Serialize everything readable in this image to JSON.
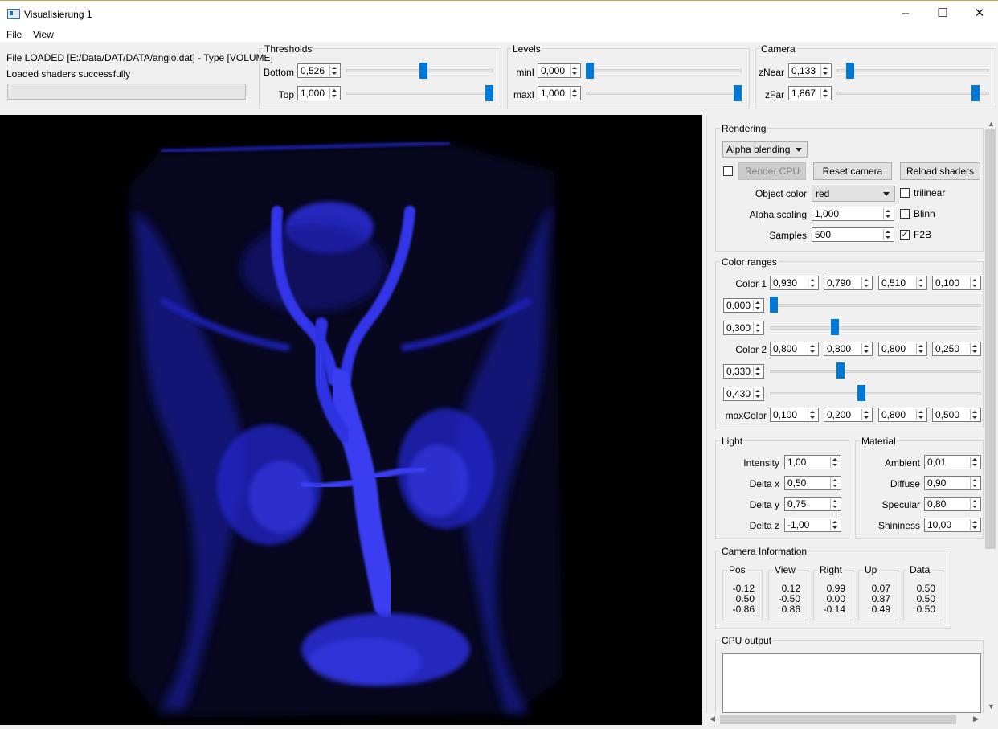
{
  "window": {
    "title": "Visualisierung 1",
    "minimize": "–",
    "maximize": "☐",
    "close": "✕"
  },
  "menu": {
    "file": "File",
    "view": "View"
  },
  "status": {
    "line1": "File LOADED [E:/Data/DAT/DATA/angio.dat] - Type [VOLUME]",
    "line2": "Loaded shaders successfully",
    "progress": 0
  },
  "thresholds": {
    "title": "Thresholds",
    "bottom_label": "Bottom",
    "bottom_value": "0,526",
    "bottom_level": 0.526,
    "top_label": "Top",
    "top_value": "1,000",
    "top_level": 1.0
  },
  "levels": {
    "title": "Levels",
    "min_label": "minI",
    "min_value": "0,000",
    "min_level": 0.0,
    "max_label": "maxI",
    "max_value": "1,000",
    "max_level": 1.0
  },
  "camera": {
    "title": "Camera",
    "znear_label": "zNear",
    "znear_value": "0,133",
    "znear_level": 0.066,
    "zfar_label": "zFar",
    "zfar_value": "1,867",
    "zfar_level": 0.934
  },
  "rendering": {
    "title": "Rendering",
    "mode": "Alpha blending",
    "render_cpu": "Render CPU",
    "reset_camera": "Reset camera",
    "reload_shaders": "Reload shaders",
    "object_color_label": "Object color",
    "object_color": "red",
    "alpha_scaling_label": "Alpha scaling",
    "alpha_scaling": "1,000",
    "samples_label": "Samples",
    "samples": "500",
    "trilinear": "trilinear",
    "blinn": "Blinn",
    "f2b": "F2B",
    "f2b_checked": "✓"
  },
  "color_ranges": {
    "title": "Color ranges",
    "color1_label": "Color 1",
    "color1": [
      "0,930",
      "0,790",
      "0,510",
      "0,100"
    ],
    "range1a": "0,000",
    "range1a_level": 0.0,
    "range1b": "0,300",
    "range1b_level": 0.3,
    "color2_label": "Color 2",
    "color2": [
      "0,800",
      "0,800",
      "0,800",
      "0,250"
    ],
    "range2a": "0,330",
    "range2a_level": 0.33,
    "range2b": "0,430",
    "range2b_level": 0.43,
    "maxcolor_label": "maxColor",
    "maxcolor": [
      "0,100",
      "0,200",
      "0,800",
      "0,500"
    ]
  },
  "light": {
    "title": "Light",
    "intensity_label": "Intensity",
    "intensity": "1,00",
    "dx_label": "Delta x",
    "dx": "0,50",
    "dy_label": "Delta y",
    "dy": "0,75",
    "dz_label": "Delta z",
    "dz": "-1,00"
  },
  "material": {
    "title": "Material",
    "ambient_label": "Ambient",
    "ambient": "0,01",
    "diffuse_label": "Diffuse",
    "diffuse": "0,90",
    "specular_label": "Specular",
    "specular": "0,80",
    "shininess_label": "Shininess",
    "shininess": "10,00"
  },
  "camera_info": {
    "title": "Camera Information",
    "pos": {
      "label": "Pos",
      "values": "-0.12\n0.50\n-0.86"
    },
    "view": {
      "label": "View",
      "values": "0.12\n-0.50\n0.86"
    },
    "right": {
      "label": "Right",
      "values": "0.99\n0.00\n-0.14"
    },
    "up": {
      "label": "Up",
      "values": "0.07\n0.87\n0.49"
    },
    "data": {
      "label": "Data",
      "values": "0.50\n0.50\n0.50"
    }
  },
  "cpu_output": {
    "title": "CPU output",
    "text": ""
  },
  "colors": {
    "accent": "#0078d7",
    "volume": "#1b1ee0",
    "viewport_bg": "#000000"
  }
}
